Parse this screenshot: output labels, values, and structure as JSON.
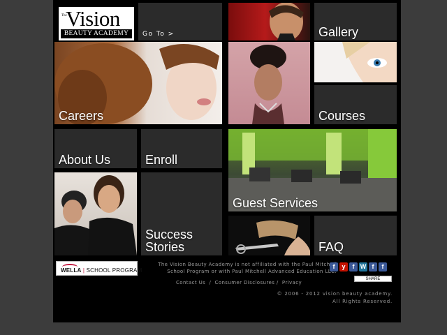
{
  "logo": {
    "the": "The",
    "vision": "Vision",
    "academy": "BEAUTY ACADEMY"
  },
  "nav": {
    "goto": "Go To >"
  },
  "tiles": {
    "gallery": "Gallery",
    "careers": "Careers",
    "courses": "Courses",
    "about": "About Us",
    "enroll": "Enroll",
    "guest": "Guest Services",
    "success": "Success\nStories",
    "faq": "FAQ"
  },
  "footer": {
    "wella_brand": "WELLA",
    "wella_program": "SCHOOL PROGRAM",
    "disclaimer": "The Vision Beauty Academy is not affiliated with the Paul Mitchell School Program or with Paul Mitchell Advanced Education LLC.",
    "links": [
      "Contact Us",
      "Consumer Disclosures",
      "Privacy"
    ],
    "copyright_line1": "© 2006 - 2012 vision beauty academy.",
    "copyright_line2": "All Rights Reserved.",
    "share_label": "SHARE"
  },
  "social": [
    {
      "icon": "facebook-icon",
      "glyph": "f",
      "color": "#3b5998"
    },
    {
      "icon": "yelp-icon",
      "glyph": "y",
      "color": "#c41200"
    },
    {
      "icon": "facebook-icon",
      "glyph": "f",
      "color": "#3b5998"
    },
    {
      "icon": "wordpress-icon",
      "glyph": "W",
      "color": "#21759b"
    },
    {
      "icon": "facebook-icon",
      "glyph": "f",
      "color": "#3b5998"
    },
    {
      "icon": "facebook-icon",
      "glyph": "f",
      "color": "#3b5998"
    }
  ],
  "colors": {
    "page_bg": "#3c3c3c",
    "panel_bg": "#000000",
    "tile_bg": "#2b2b2b",
    "text": "#ffffff",
    "footer_text": "#9a9a9a",
    "accent_green": "#7ec132"
  }
}
